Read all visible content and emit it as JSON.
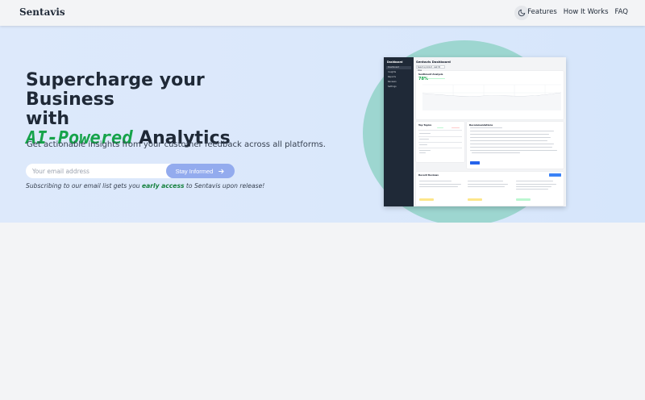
{
  "header": {
    "brand": "Sentavis",
    "theme_toggle_icon": "moon-icon",
    "nav": [
      "Features",
      "How It Works",
      "FAQ"
    ]
  },
  "hero": {
    "headline_line1": "Supercharge your Business",
    "headline_line2": "with",
    "headline_ai": "AI-Powered",
    "headline_rest": " Analytics",
    "subtitle": "Get actionable insights from your customer feedback across all platforms.",
    "email_placeholder": "Your email address",
    "button_label": "Stay Informed",
    "button_icon": "arrow-right-icon",
    "note_prefix": "Subscribing to our email list gets you ",
    "note_highlight": "early access",
    "note_suffix": " to Sentavis upon release!"
  },
  "colors": {
    "accent_green": "#16a34a",
    "button": "#93abee",
    "circle": "#9dd6d0",
    "sidebar": "#1f2937"
  },
  "dashboard": {
    "sidebar_title": "Dashboard",
    "sidebar_items": [
      "Dashboard",
      "Insights",
      "Reports",
      "Reviews",
      "Settings"
    ],
    "title": "Sentavis Dashboard",
    "select": "Select a product · Last 30 days",
    "sentiment_title": "Sentiment Analysis",
    "sentiment_value": "78%",
    "top_topics_title": "Top Topics",
    "recommendations_title": "Recommendations",
    "recent_reviews_title": "Recent Reviews"
  }
}
